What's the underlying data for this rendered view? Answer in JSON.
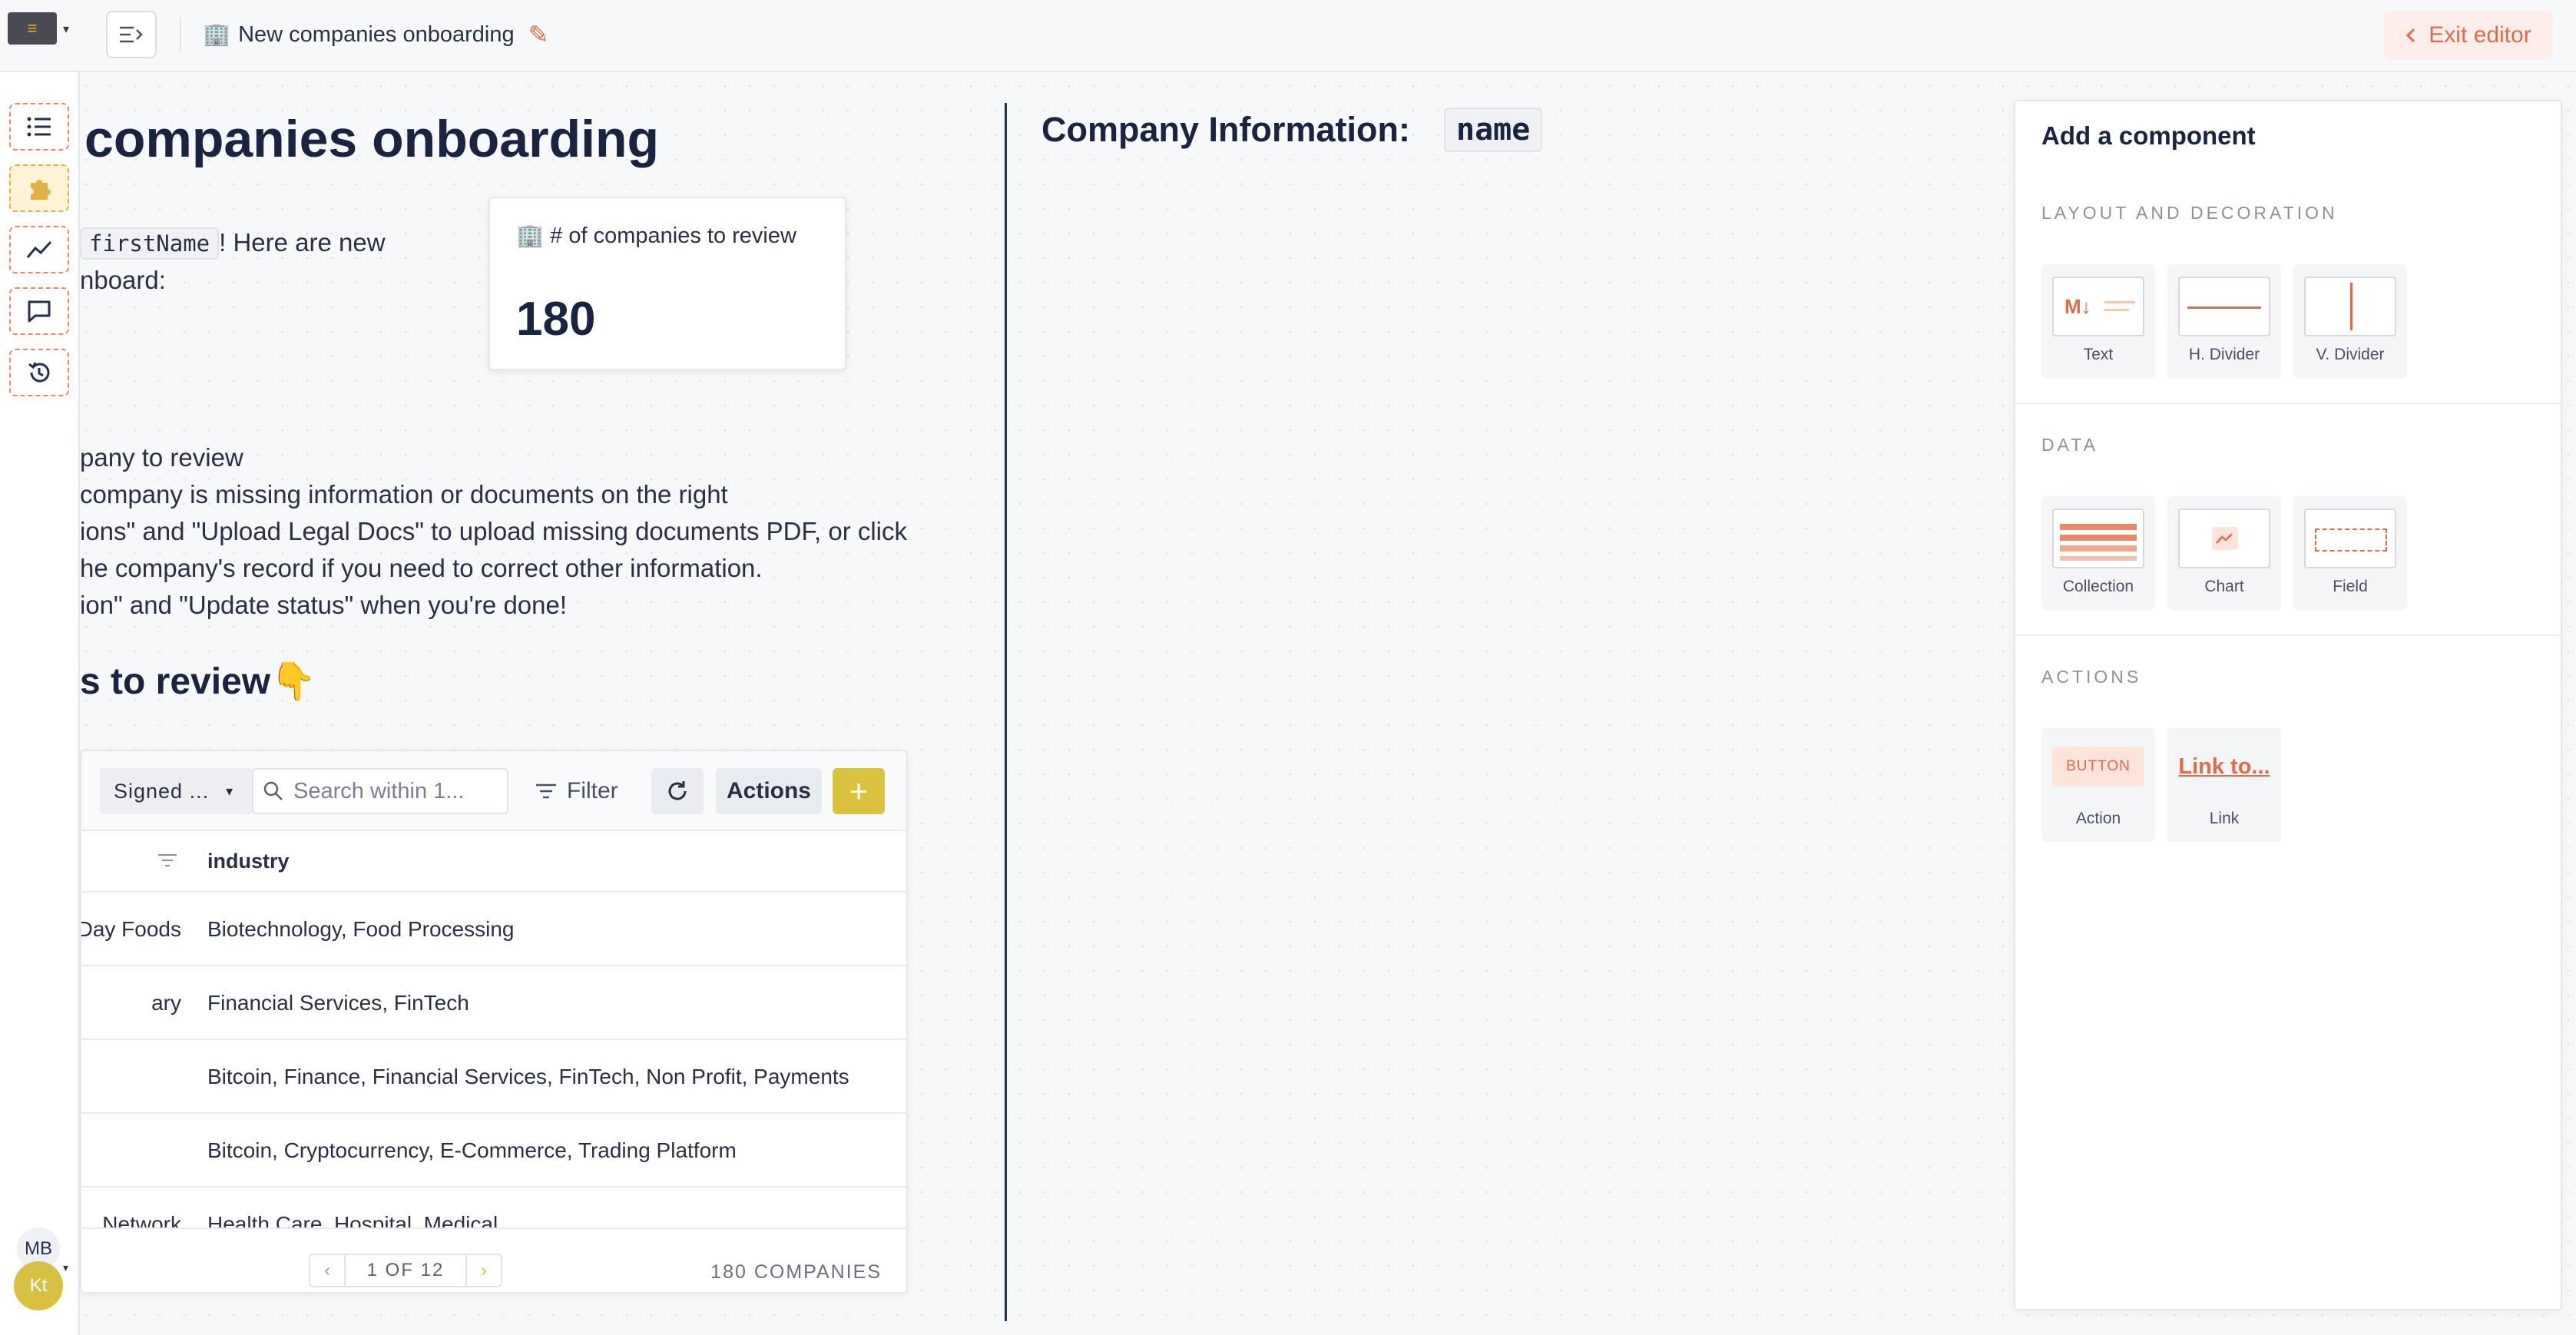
{
  "topbar": {
    "title_icon": "🏢",
    "title": "New companies onboarding",
    "exit_label": "Exit editor"
  },
  "rail": {
    "items": [
      "list-icon",
      "puzzle-icon",
      "chart-line-icon",
      "comment-icon",
      "history-icon"
    ],
    "user_initials": "MB",
    "org_initials": "Kt"
  },
  "main": {
    "heading": "companies onboarding",
    "greeting_var": "firstName",
    "greeting_rest": "! Here are new",
    "greeting_line2": "nboard:",
    "kpi": {
      "icon": "🏢",
      "label": "# of companies to review",
      "value": "180"
    },
    "instructions": [
      "pany to review",
      "company is missing information or documents on the right",
      "ions\" and \"Upload Legal Docs\" to upload missing documents PDF, or click",
      "he company's record if you need to correct other information.",
      "ion\" and \"Update status\" when you're done!"
    ],
    "subheading": "s to review",
    "subheading_emoji": "👇"
  },
  "table": {
    "filter_value": "Signed ...",
    "search_placeholder": "Search within 1...",
    "filter_label": "Filter",
    "actions_label": "Actions",
    "add_label": "+",
    "column_header": "industry",
    "rows": [
      {
        "name": "Day Foods",
        "industry": "Biotechnology, Food Processing"
      },
      {
        "name": "ary",
        "industry": "Financial Services, FinTech"
      },
      {
        "name": "",
        "industry": "Bitcoin, Finance, Financial Services, FinTech, Non Profit, Payments"
      },
      {
        "name": "",
        "industry": "Bitcoin, Cryptocurrency, E-Commerce, Trading Platform"
      },
      {
        "name": "Network",
        "industry": "Health Care, Hospital, Medical"
      }
    ],
    "pagination": "1 OF 12",
    "count": "180 COMPANIES"
  },
  "middle": {
    "label": "Company Information:",
    "field_chip": "name"
  },
  "panel": {
    "title": "Add a component",
    "sections": {
      "layout": "LAYOUT AND DECORATION",
      "data": "DATA",
      "actions": "ACTIONS"
    },
    "tiles": {
      "text": "Text",
      "hdivider": "H. Divider",
      "vdivider": "V. Divider",
      "collection": "Collection",
      "chart": "Chart",
      "field": "Field",
      "action": "Action",
      "link": "Link"
    },
    "tile_previews": {
      "text": "M↓",
      "action": "BUTTON",
      "link": "Link to..."
    }
  },
  "colors": {
    "accent": "#e06b4a",
    "brand": "#d9c23e",
    "text": "#1a2340"
  }
}
